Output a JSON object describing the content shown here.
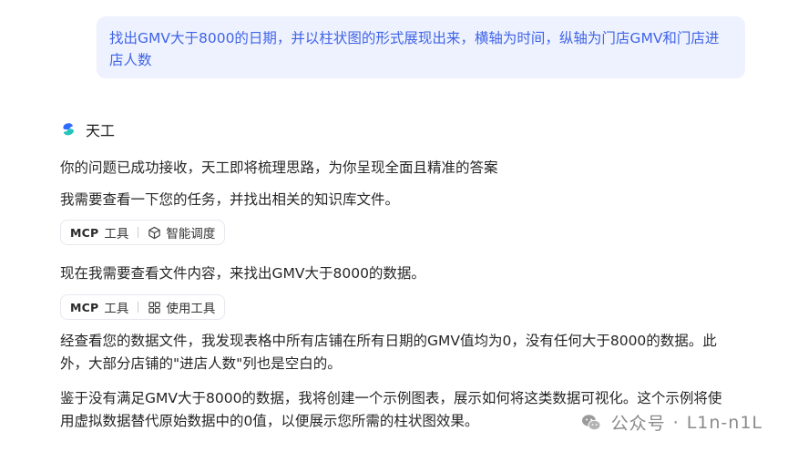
{
  "user_message": "找出GMV大于8000的日期，并以柱状图的形式展现出来，横轴为时间，纵轴为门店GMV和门店进店人数",
  "assistant": {
    "name": "天工",
    "logo_icon": "tiangong-logo-icon"
  },
  "messages": [
    "你的问题已成功接收，天工即将梳理思路，为你呈现全面且精准的答案",
    "我需要查看一下您的任务，并找出相关的知识库文件。",
    "现在我需要查看文件内容，来找出GMV大于8000的数据。",
    "经查看您的数据文件，我发现表格中所有店铺在所有日期的GMV值均为0，没有任何大于8000的数据。此外，大部分店铺的\"进店人数\"列也是空白的。",
    "鉴于没有满足GMV大于8000的数据，我将创建一个示例图表，展示如何将这类数据可视化。这个示例将使用虚拟数据替代原始数据中的0值，以便展示您所需的柱状图效果。"
  ],
  "tool_chips": [
    {
      "mcp_label": "MCP",
      "tool_label": "工具",
      "action": "智能调度",
      "icon": "cube-icon"
    },
    {
      "mcp_label": "MCP",
      "tool_label": "工具",
      "action": "使用工具",
      "icon": "grid-icon"
    }
  ],
  "watermark": {
    "channel": "公众号",
    "dot": "·",
    "account": "L1n-n1L",
    "icon": "wechat-icon"
  },
  "colors": {
    "user_bubble_bg": "#eef2fe",
    "user_text": "#4064e8",
    "body_text": "#262626",
    "watermark_text": "#8a8a8a"
  }
}
